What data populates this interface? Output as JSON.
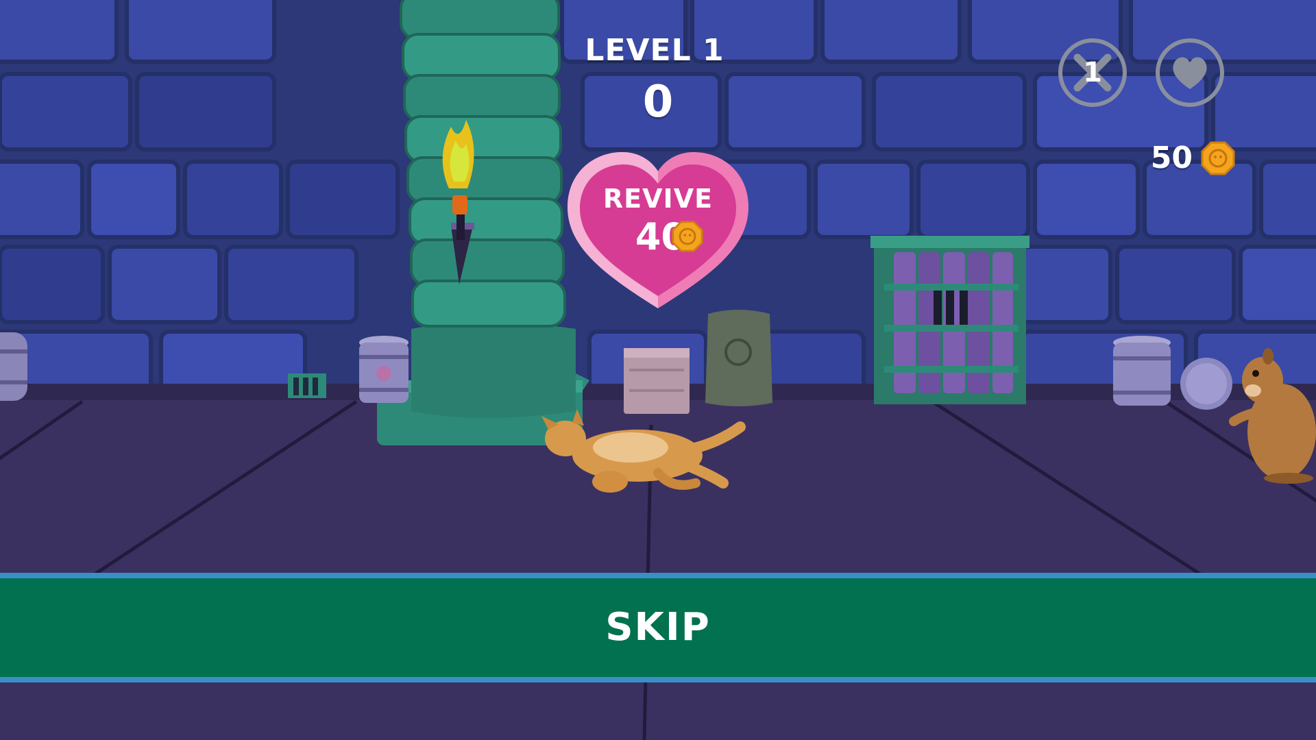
{
  "hud": {
    "level_label": "LEVEL 1",
    "score": "0",
    "coins": "50",
    "lives_count": "1"
  },
  "revive": {
    "label": "REVIVE",
    "cost": "40"
  },
  "skip": {
    "label": "SKIP"
  },
  "icons": {
    "lives": "x-circle-icon",
    "favorite": "heart-icon",
    "coin": "coin-icon"
  },
  "colors": {
    "wall_blue": "#34418f",
    "floor_purple": "#3b3160",
    "pillar_teal": "#2e8a78",
    "revive_pink": "#d63c93",
    "skip_green": "#017150",
    "skip_border": "#3b8fc8",
    "coin_gold": "#f3a51e"
  }
}
